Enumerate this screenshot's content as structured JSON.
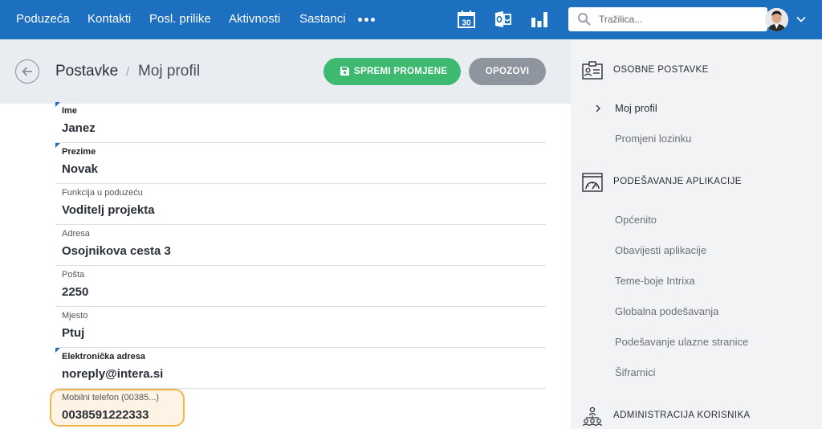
{
  "topnav": {
    "items": [
      "Poduzeća",
      "Kontakti",
      "Posl. prilike",
      "Aktivnosti",
      "Sastanci"
    ],
    "more_icon": "more-dots-icon",
    "icons": [
      "calendar-icon",
      "outlook-sync-icon",
      "bar-chart-icon"
    ],
    "calendar_day": "30",
    "search_placeholder": "Tražilica...",
    "user_menu_icon": "chevron-down-icon"
  },
  "header": {
    "title": "Postavke",
    "separator": "/",
    "subtitle": "Moj profil",
    "save_label": "SPREMI PROMJENE",
    "cancel_label": "OPOZOVI"
  },
  "form": {
    "fields": [
      {
        "label": "Ime",
        "value": "Janez",
        "required": true
      },
      {
        "label": "Prezime",
        "value": "Novak",
        "required": true
      },
      {
        "label": "Funkcija u poduzeću",
        "value": "Voditelj projekta",
        "required": false
      },
      {
        "label": "Adresa",
        "value": "Osojnikova cesta 3",
        "required": false
      },
      {
        "label": "Pošta",
        "value": "2250",
        "required": false
      },
      {
        "label": "Mjesto",
        "value": "Ptuj",
        "required": false
      },
      {
        "label": "Elektronička adresa",
        "value": "noreply@intera.si",
        "required": true
      },
      {
        "label": "Mobilni telefon (00385...)",
        "value": "0038591222333",
        "required": false
      }
    ]
  },
  "sidebar": {
    "sections": [
      {
        "title": "OSOBNE POSTAVKE",
        "icon": "id-card-icon",
        "items": [
          "Moj profil",
          "Promjeni lozinku"
        ]
      },
      {
        "title": "PODEŠAVANJE APLIKACIJE",
        "icon": "app-gauge-icon",
        "items": [
          "Općenito",
          "Obavijesti aplikacije",
          "Teme-boje Intrixa",
          "Globalna podešavanja",
          "Podešavanje ulazne stranice",
          "Šifrarnici"
        ]
      },
      {
        "title": "ADMINISTRACIJA KORISNIKA",
        "icon": "users-hierarchy-icon",
        "items": []
      }
    ],
    "active_item": "Moj profil"
  },
  "colors": {
    "topbar": "#1d6fbf",
    "save_button": "#3dba6f",
    "cancel_button": "#8f959e",
    "highlight_border": "#f3b54a",
    "highlight_fill": "#fdf4e6"
  }
}
